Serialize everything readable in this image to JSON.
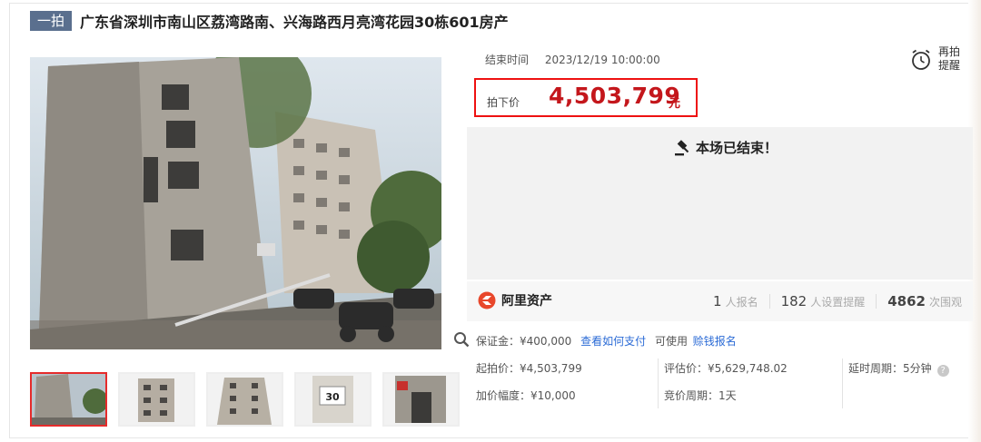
{
  "title": {
    "badge": "一拍",
    "text": "广东省深圳市南山区荔湾路南、兴海路西月亮湾花园30栋601房产"
  },
  "auction": {
    "end_time_label": "结束时间",
    "end_time_value": "2023/12/19 10:00:00",
    "remind_label": "再拍提醒",
    "price_label": "拍下价",
    "price_value": "4,503,799",
    "price_unit": "元",
    "status_text": "本场已结束！"
  },
  "brand": {
    "name": "阿里资产",
    "color": "#e8472b"
  },
  "stats": {
    "signups": "1",
    "signups_label": "人报名",
    "reminders": "182",
    "reminders_label": "人设置提醒",
    "views": "4862",
    "views_label": "次围观"
  },
  "deposit": {
    "text": "保证金：¥400,000",
    "how_to_pay": "查看如何支付",
    "usable": "可使用",
    "earn_signup": "赊钱报名"
  },
  "details": {
    "start_price": "起拍价：¥4,503,799",
    "appraisal": "评估价：¥5,629,748.02",
    "delay": "延时周期：5分钟",
    "increment": "加价幅度：¥10,000",
    "cycle": "竞价周期：1天"
  },
  "colors": {
    "price_red": "#c4171c",
    "highlight_border": "#e11111",
    "link_blue": "#2b6bd6",
    "badge_bg": "#5a6f8e"
  },
  "thumbnails": [
    {
      "icon": "building-photo",
      "active": true
    },
    {
      "icon": "building-photo",
      "active": false
    },
    {
      "icon": "building-photo",
      "active": false
    },
    {
      "icon": "house-number-photo",
      "active": false,
      "text": "30"
    },
    {
      "icon": "entrance-photo",
      "active": false
    }
  ]
}
